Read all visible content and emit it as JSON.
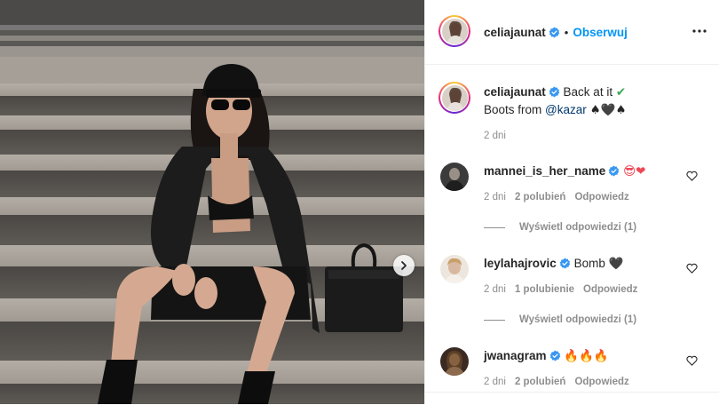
{
  "header": {
    "username": "celiajaunat",
    "follow_label": "Obserwuj",
    "separator": "•"
  },
  "caption": {
    "username": "celiajaunat",
    "line1": "Back at it",
    "line1_emoji": "✔",
    "line2_prefix": "Boots from ",
    "mention": "@kazar",
    "line2_emoji": "♠🖤♠",
    "time": "2 dni"
  },
  "comments": [
    {
      "username": "mannei_is_her_name",
      "text": "",
      "emoji": "😎❤",
      "time": "2 dni",
      "likes": "2 polubień",
      "reply": "Odpowiedz",
      "view_replies": "Wyświetl odpowiedzi (1)"
    },
    {
      "username": "leylahajrovic",
      "text": "Bomb ",
      "emoji": "🖤",
      "time": "2 dni",
      "likes": "1 polubienie",
      "reply": "Odpowiedz",
      "view_replies": "Wyświetl odpowiedzi (1)"
    },
    {
      "username": "jwanagram",
      "text": "",
      "emoji": "🔥🔥🔥",
      "time": "2 dni",
      "likes": "2 polubień",
      "reply": "Odpowiedz"
    }
  ],
  "colors": {
    "link_blue": "#0095f6",
    "verified_blue": "#3897f0",
    "muted": "#8e8e8e",
    "text": "#262626",
    "check_green": "#3aa757"
  },
  "icons": {
    "carousel_next": "chevron-right-icon",
    "more": "more-horizontal-icon",
    "verified": "verified-badge-icon",
    "like": "heart-outline-icon"
  }
}
